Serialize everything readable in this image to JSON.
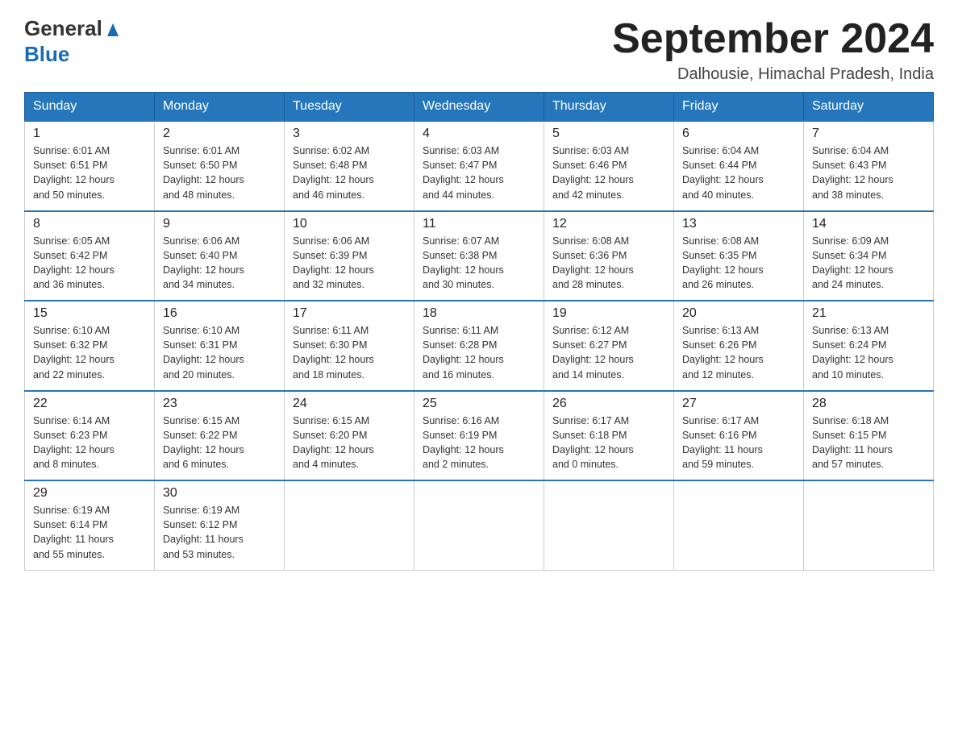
{
  "header": {
    "logo_general": "General",
    "logo_blue": "Blue",
    "calendar_title": "September 2024",
    "location": "Dalhousie, Himachal Pradesh, India"
  },
  "days_of_week": [
    "Sunday",
    "Monday",
    "Tuesday",
    "Wednesday",
    "Thursday",
    "Friday",
    "Saturday"
  ],
  "weeks": [
    [
      {
        "day": "1",
        "sunrise": "6:01 AM",
        "sunset": "6:51 PM",
        "daylight": "12 hours and 50 minutes."
      },
      {
        "day": "2",
        "sunrise": "6:01 AM",
        "sunset": "6:50 PM",
        "daylight": "12 hours and 48 minutes."
      },
      {
        "day": "3",
        "sunrise": "6:02 AM",
        "sunset": "6:48 PM",
        "daylight": "12 hours and 46 minutes."
      },
      {
        "day": "4",
        "sunrise": "6:03 AM",
        "sunset": "6:47 PM",
        "daylight": "12 hours and 44 minutes."
      },
      {
        "day": "5",
        "sunrise": "6:03 AM",
        "sunset": "6:46 PM",
        "daylight": "12 hours and 42 minutes."
      },
      {
        "day": "6",
        "sunrise": "6:04 AM",
        "sunset": "6:44 PM",
        "daylight": "12 hours and 40 minutes."
      },
      {
        "day": "7",
        "sunrise": "6:04 AM",
        "sunset": "6:43 PM",
        "daylight": "12 hours and 38 minutes."
      }
    ],
    [
      {
        "day": "8",
        "sunrise": "6:05 AM",
        "sunset": "6:42 PM",
        "daylight": "12 hours and 36 minutes."
      },
      {
        "day": "9",
        "sunrise": "6:06 AM",
        "sunset": "6:40 PM",
        "daylight": "12 hours and 34 minutes."
      },
      {
        "day": "10",
        "sunrise": "6:06 AM",
        "sunset": "6:39 PM",
        "daylight": "12 hours and 32 minutes."
      },
      {
        "day": "11",
        "sunrise": "6:07 AM",
        "sunset": "6:38 PM",
        "daylight": "12 hours and 30 minutes."
      },
      {
        "day": "12",
        "sunrise": "6:08 AM",
        "sunset": "6:36 PM",
        "daylight": "12 hours and 28 minutes."
      },
      {
        "day": "13",
        "sunrise": "6:08 AM",
        "sunset": "6:35 PM",
        "daylight": "12 hours and 26 minutes."
      },
      {
        "day": "14",
        "sunrise": "6:09 AM",
        "sunset": "6:34 PM",
        "daylight": "12 hours and 24 minutes."
      }
    ],
    [
      {
        "day": "15",
        "sunrise": "6:10 AM",
        "sunset": "6:32 PM",
        "daylight": "12 hours and 22 minutes."
      },
      {
        "day": "16",
        "sunrise": "6:10 AM",
        "sunset": "6:31 PM",
        "daylight": "12 hours and 20 minutes."
      },
      {
        "day": "17",
        "sunrise": "6:11 AM",
        "sunset": "6:30 PM",
        "daylight": "12 hours and 18 minutes."
      },
      {
        "day": "18",
        "sunrise": "6:11 AM",
        "sunset": "6:28 PM",
        "daylight": "12 hours and 16 minutes."
      },
      {
        "day": "19",
        "sunrise": "6:12 AM",
        "sunset": "6:27 PM",
        "daylight": "12 hours and 14 minutes."
      },
      {
        "day": "20",
        "sunrise": "6:13 AM",
        "sunset": "6:26 PM",
        "daylight": "12 hours and 12 minutes."
      },
      {
        "day": "21",
        "sunrise": "6:13 AM",
        "sunset": "6:24 PM",
        "daylight": "12 hours and 10 minutes."
      }
    ],
    [
      {
        "day": "22",
        "sunrise": "6:14 AM",
        "sunset": "6:23 PM",
        "daylight": "12 hours and 8 minutes."
      },
      {
        "day": "23",
        "sunrise": "6:15 AM",
        "sunset": "6:22 PM",
        "daylight": "12 hours and 6 minutes."
      },
      {
        "day": "24",
        "sunrise": "6:15 AM",
        "sunset": "6:20 PM",
        "daylight": "12 hours and 4 minutes."
      },
      {
        "day": "25",
        "sunrise": "6:16 AM",
        "sunset": "6:19 PM",
        "daylight": "12 hours and 2 minutes."
      },
      {
        "day": "26",
        "sunrise": "6:17 AM",
        "sunset": "6:18 PM",
        "daylight": "12 hours and 0 minutes."
      },
      {
        "day": "27",
        "sunrise": "6:17 AM",
        "sunset": "6:16 PM",
        "daylight": "11 hours and 59 minutes."
      },
      {
        "day": "28",
        "sunrise": "6:18 AM",
        "sunset": "6:15 PM",
        "daylight": "11 hours and 57 minutes."
      }
    ],
    [
      {
        "day": "29",
        "sunrise": "6:19 AM",
        "sunset": "6:14 PM",
        "daylight": "11 hours and 55 minutes."
      },
      {
        "day": "30",
        "sunrise": "6:19 AM",
        "sunset": "6:12 PM",
        "daylight": "11 hours and 53 minutes."
      },
      null,
      null,
      null,
      null,
      null
    ]
  ]
}
